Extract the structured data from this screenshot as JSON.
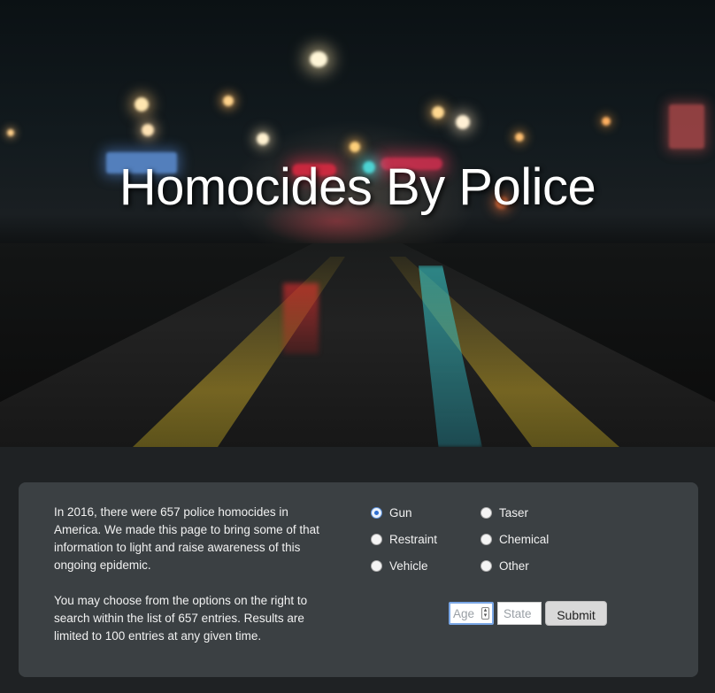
{
  "hero": {
    "title": "Homocides By Police"
  },
  "intro": {
    "paragraph1": "In 2016, there were 657 police homocides in America. We made this page to bring some of that information to light and raise awareness of this ongoing epidemic.",
    "paragraph2": "You may choose from the options on the right to search within the list of 657 entries. Results are limited to 100 entries at any given time."
  },
  "methods": {
    "selected": "Gun",
    "options": [
      {
        "label": "Gun",
        "checked": true
      },
      {
        "label": "Taser",
        "checked": false
      },
      {
        "label": "Restraint",
        "checked": false
      },
      {
        "label": "Chemical",
        "checked": false
      },
      {
        "label": "Vehicle",
        "checked": false
      },
      {
        "label": "Other",
        "checked": false
      }
    ]
  },
  "search": {
    "age_placeholder": "Age",
    "state_placeholder": "State",
    "submit_label": "Submit"
  }
}
